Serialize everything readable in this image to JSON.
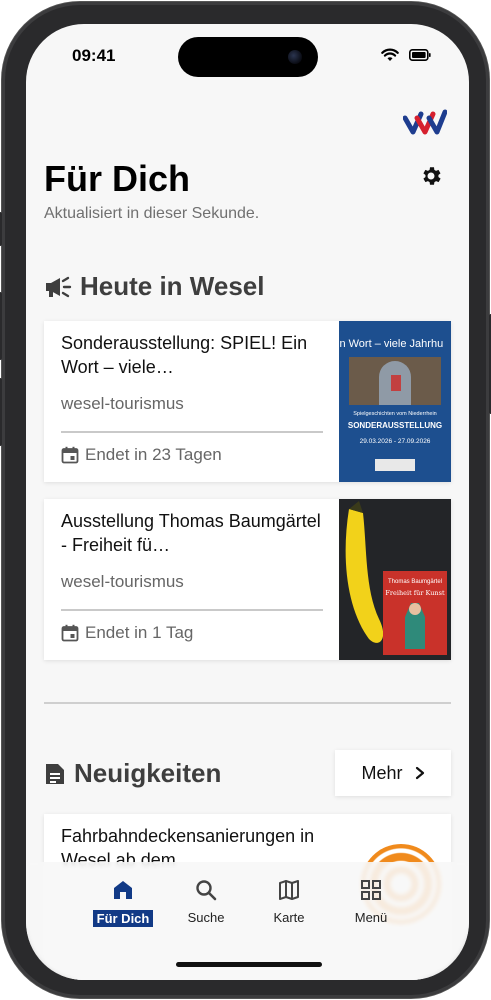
{
  "status_bar": {
    "time": "09:41"
  },
  "page": {
    "title": "Für Dich",
    "subtitle": "Aktualisiert in dieser Sekunde."
  },
  "sections": {
    "today": {
      "heading": "Heute in Wesel",
      "icon": "megaphone-icon",
      "cards": [
        {
          "title": "Sonderausstellung: SPIEL! Ein Wort – viele…",
          "source": "wesel-tourismus",
          "date": "Endet in 23 Tagen",
          "image_texts": [
            "in Wort – viele Jahrhu",
            "Spielgeschichten vom Niederrhein",
            "SONDERAUSSTELLUNG",
            "29.03.2026 - 27.09.2026"
          ]
        },
        {
          "title": "Ausstellung Thomas Baumgärtel - Freiheit fü…",
          "source": "wesel-tourismus",
          "date": "Endet in 1 Tag",
          "image_texts": [
            "Thomas Baumgärtel",
            "Freiheit für Kunst"
          ]
        }
      ]
    },
    "news": {
      "heading": "Neuigkeiten",
      "icon": "document-icon",
      "more_label": "Mehr",
      "cards": [
        {
          "title": "Fahrbahndeckensanierungen in Wesel ab dem"
        }
      ]
    }
  },
  "tabbar": {
    "tabs": [
      {
        "label": "Für Dich",
        "icon": "home-icon",
        "active": true
      },
      {
        "label": "Suche",
        "icon": "search-icon",
        "active": false
      },
      {
        "label": "Karte",
        "icon": "map-icon",
        "active": false
      },
      {
        "label": "Menü",
        "icon": "grid-icon",
        "active": false
      }
    ]
  },
  "colors": {
    "accent": "#123a86",
    "logo_blue": "#1e3d8f",
    "logo_red": "#d6202e",
    "background": "#f7f7f7"
  }
}
